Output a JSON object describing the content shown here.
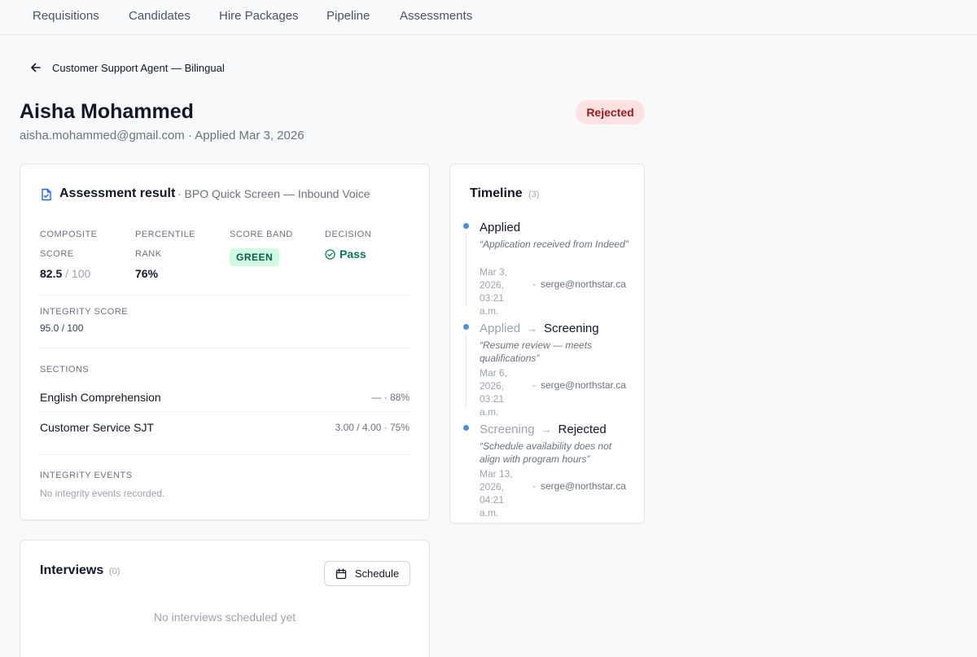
{
  "nav": {
    "items": [
      "Requisitions",
      "Candidates",
      "Hire Packages",
      "Pipeline",
      "Assessments"
    ]
  },
  "back": {
    "label": "Customer Support Agent — Bilingual",
    "icon": "arrow-left-icon"
  },
  "candidate": {
    "name": "Aisha Mohammed",
    "subtitle": "aisha.mohammed@gmail.com · Applied Mar 3, 2026",
    "status": "Rejected"
  },
  "assessment": {
    "title": "Assessment result",
    "subtitle": "· BPO Quick Screen — Inbound Voice",
    "icon": "document-icon",
    "composite_label_1": "COMPOSITE",
    "composite_label_2": "SCORE",
    "composite_value": "82.5",
    "composite_max": " / 100",
    "percentile_label_1": "PERCENTILE",
    "percentile_label_2": "RANK",
    "percentile_value": "76%",
    "band_label": "SCORE BAND",
    "band_value": "GREEN",
    "decision_label": "DECISION",
    "decision_value": "Pass",
    "integrity_label": "INTEGRITY SCORE",
    "integrity_value": "95.0 / 100",
    "sections_label": "SECTIONS",
    "sections": [
      {
        "name": "English Comprehension",
        "value": "— · 88%"
      },
      {
        "name": "Customer Service SJT",
        "value": "3.00 / 4.00 · 75%"
      }
    ],
    "events_label": "INTEGRITY EVENTS",
    "events_empty": "No integrity events recorded."
  },
  "timeline": {
    "title": "Timeline",
    "count": "(3)",
    "entries": [
      {
        "from": "",
        "to": "Applied",
        "note": "“Application received from Indeed”",
        "date": "Mar 3, 2026, 03:21 a.m.",
        "user": "serge@northstar.ca"
      },
      {
        "from": "Applied",
        "to": "Screening",
        "note": "“Resume review — meets qualifications”",
        "date": "Mar 6, 2026, 03:21 a.m.",
        "user": "serge@northstar.ca"
      },
      {
        "from": "Screening",
        "to": "Rejected",
        "note": "“Schedule availability does not align with program hours”",
        "date": "Mar 13, 2026, 04:21 a.m.",
        "user": "serge@northstar.ca"
      }
    ]
  },
  "interviews": {
    "title": "Interviews",
    "count": "(0)",
    "schedule_label": "Schedule",
    "schedule_icon": "calendar-icon",
    "empty": "No interviews scheduled yet"
  },
  "colors": {
    "accent": "#4a90e2",
    "pass": "#047857",
    "rejected_bg": "#fee2e2",
    "rejected_text": "#991b1b"
  }
}
